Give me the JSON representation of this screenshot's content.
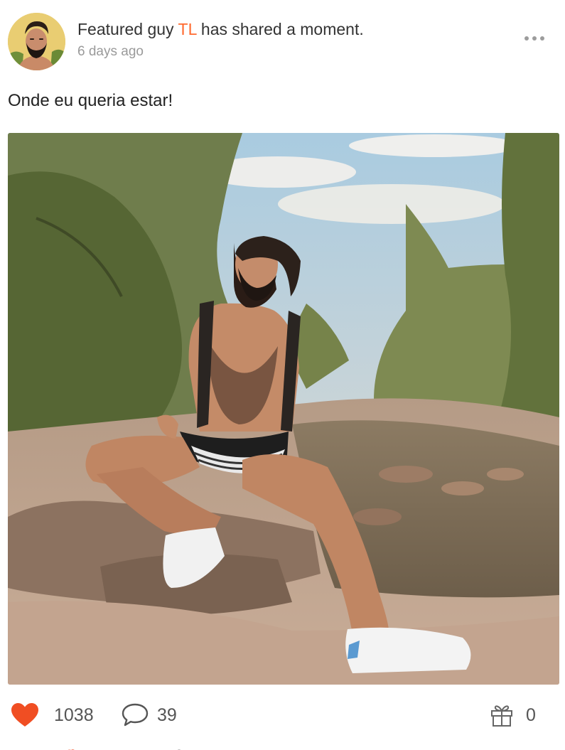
{
  "post": {
    "headline_prefix": "Featured guy",
    "user_name": "TL",
    "headline_suffix": "has shared a moment.",
    "timestamp": "6 days ago",
    "caption": "Onde eu queria estar!",
    "more_icon": "more-horizontal-icon"
  },
  "actions": {
    "likes": "1038",
    "comments": "39",
    "gifts": "0",
    "like_icon": "heart-icon",
    "comment_icon": "comment-icon",
    "gift_icon": "gift-icon"
  },
  "colors": {
    "accent": "#ff6a2f",
    "heart": "#f04e23",
    "muted_text": "#9a9a9a",
    "count_text": "#555555"
  }
}
